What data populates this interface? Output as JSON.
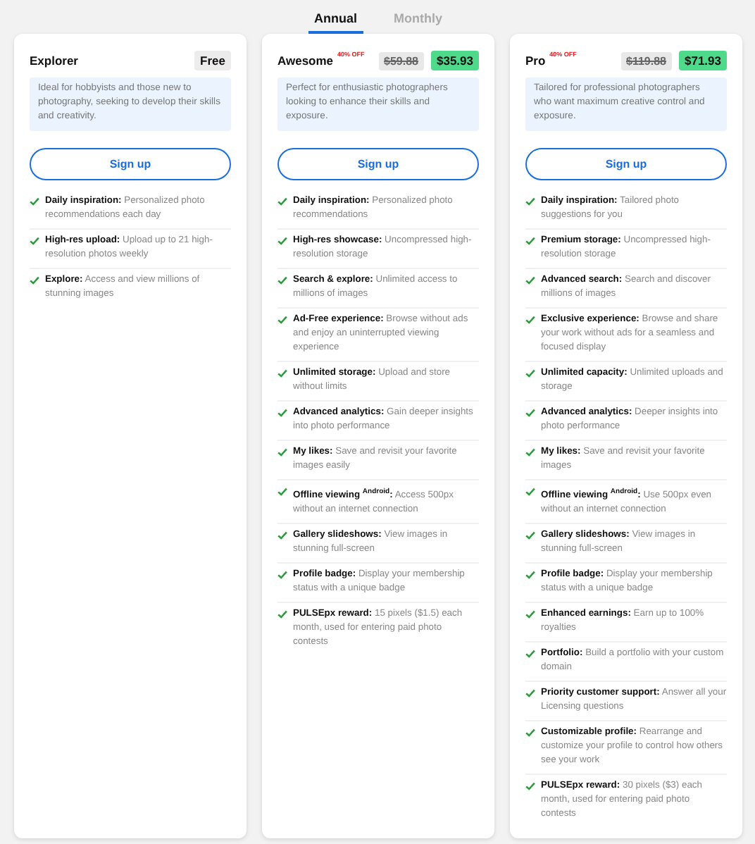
{
  "tabs": [
    {
      "label": "Annual",
      "selected": true
    },
    {
      "label": "Monthly",
      "selected": false
    }
  ],
  "plans": [
    {
      "name": "Explorer",
      "price": "Free",
      "kind": "plain",
      "description": "Ideal for hobbyists and those new to photography, seeking to develop their skills and creativity.",
      "button": "Sign up",
      "features": [
        {
          "title": "Daily inspiration:",
          "text": "Personalized photo recommendations each day"
        },
        {
          "title": "High-res upload:",
          "text": "Upload up to 21 high-resolution photos weekly"
        },
        {
          "title": "Explore:",
          "text": "Access and view millions of stunning images"
        }
      ]
    },
    {
      "name": "Awesome",
      "discount": "40% OFF",
      "old_price": "$59.88",
      "price": "$35.93",
      "kind": "sale",
      "description": "Perfect for enthusiastic photographers looking to enhance their skills and exposure.",
      "button": "Sign up",
      "features": [
        {
          "title": "Daily inspiration:",
          "text": "Personalized photo recommendations"
        },
        {
          "title": "High-res showcase:",
          "text": "Uncompressed high-resolution storage"
        },
        {
          "title": "Search & explore:",
          "text": "Unlimited access to millions of images"
        },
        {
          "title": "Ad-Free experience:",
          "text": "Browse without ads and enjoy an uninterrupted viewing experience"
        },
        {
          "title": "Unlimited storage:",
          "text": "Upload and store without limits"
        },
        {
          "title": "Advanced analytics:",
          "text": "Gain deeper insights into photo performance"
        },
        {
          "title": "My likes:",
          "text": "Save and revisit your favorite images easily"
        },
        {
          "title": "Offline viewing $^{Android}$:",
          "text": "Access 500px without an internet connection"
        },
        {
          "title": "Gallery slideshows:",
          "text": "View images in stunning full-screen"
        },
        {
          "title": "Profile badge:",
          "text": "Display your membership status with a unique badge"
        },
        {
          "title": "PULSEpx reward:",
          "text": "15 pixels ($1.5) each month, used for entering paid photo contests"
        }
      ]
    },
    {
      "name": "Pro",
      "discount": "40% OFF",
      "old_price": "$119.88",
      "price": "$71.93",
      "kind": "sale",
      "description": "Tailored for professional photographers who want maximum creative control and exposure.",
      "button": "Sign up",
      "features": [
        {
          "title": "Daily inspiration:",
          "text": "Tailored photo suggestions for you"
        },
        {
          "title": "Premium storage:",
          "text": "Uncompressed high-resolution storage"
        },
        {
          "title": "Advanced search:",
          "text": "Search and discover millions of images"
        },
        {
          "title": "Exclusive experience:",
          "text": "Browse and share your work without ads for a seamless and focused display"
        },
        {
          "title": "Unlimited capacity:",
          "text": "Unlimited uploads and storage"
        },
        {
          "title": "Advanced analytics:",
          "text": "Deeper insights into photo performance"
        },
        {
          "title": "My likes:",
          "text": "Save and revisit your favorite images"
        },
        {
          "title": "Offline viewing $^{Android}$:",
          "text": "Use 500px even without an internet connection"
        },
        {
          "title": "Gallery slideshows:",
          "text": "View images in stunning full-screen"
        },
        {
          "title": "Profile badge:",
          "text": "Display your membership status with a unique badge"
        },
        {
          "title": "Enhanced earnings:",
          "text": "Earn up to 100% royalties"
        },
        {
          "title": "Portfolio:",
          "text": "Build a portfolio with your custom domain"
        },
        {
          "title": "Priority customer support:",
          "text": "Answer all your Licensing questions"
        },
        {
          "title": "Customizable profile:",
          "text": "Rearrange and customize your profile to control how others see your work"
        },
        {
          "title": "PULSEpx reward:",
          "text": "30 pixels ($3) each month, used for entering paid photo contests"
        }
      ]
    }
  ]
}
